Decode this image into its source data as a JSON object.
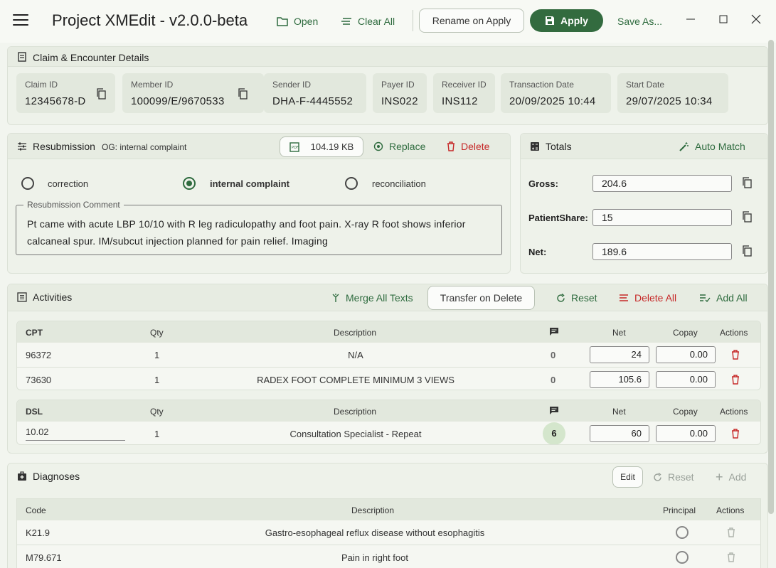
{
  "window": {
    "title": "Project XMEdit - v2.0.0-beta"
  },
  "toolbar": {
    "open_label": "Open",
    "clear_all_label": "Clear All",
    "rename_label": "Rename on Apply",
    "apply_label": "Apply",
    "save_as_label": "Save As..."
  },
  "claim": {
    "section_title": "Claim & Encounter Details",
    "fields": [
      {
        "label": "Claim ID",
        "value": "12345678-D"
      },
      {
        "label": "Member ID",
        "value": "100099/E/9670533"
      },
      {
        "label": "Sender ID",
        "value": "DHA-F-4445552"
      },
      {
        "label": "Payer ID",
        "value": "INS022"
      },
      {
        "label": "Receiver ID",
        "value": "INS112"
      },
      {
        "label": "Transaction Date",
        "value": "20/09/2025 10:44"
      },
      {
        "label": "Start Date",
        "value": "29/07/2025 10:34"
      }
    ]
  },
  "resubmission": {
    "section_title": "Resubmission",
    "og_label": "OG: internal complaint",
    "file_size": "104.19 KB",
    "replace_label": "Replace",
    "delete_label": "Delete",
    "options": [
      "correction",
      "internal complaint",
      "reconciliation"
    ],
    "selected": "internal complaint",
    "comment_label": "Resubmission Comment",
    "comment_text": "Pt came with acute LBP 10/10 with R leg radiculopathy and foot pain. X-ray R foot shows inferior calcaneal spur. IM/subcut injection planned for pain relief. Imaging"
  },
  "totals": {
    "section_title": "Totals",
    "auto_match_label": "Auto Match",
    "items": [
      {
        "label": "Gross:",
        "value": "204.6"
      },
      {
        "label": "PatientShare:",
        "value": "15"
      },
      {
        "label": "Net:",
        "value": "189.6"
      }
    ]
  },
  "activities": {
    "section_title": "Activities",
    "merge_label": "Merge All Texts",
    "transfer_label": "Transfer on Delete",
    "reset_label": "Reset",
    "delete_all_label": "Delete All",
    "add_all_label": "Add All",
    "groups": [
      {
        "code_header": "CPT",
        "qty_header": "Qty",
        "desc_header": "Description",
        "net_header": "Net",
        "copay_header": "Copay",
        "actions_header": "Actions",
        "rows": [
          {
            "code": "96372",
            "qty": "1",
            "desc": "N/A",
            "comments": "0",
            "net": "24",
            "copay": "0.00"
          },
          {
            "code": "73630",
            "qty": "1",
            "desc": "RADEX FOOT COMPLETE MINIMUM 3 VIEWS",
            "comments": "0",
            "net": "105.6",
            "copay": "0.00"
          }
        ]
      },
      {
        "code_header": "DSL",
        "qty_header": "Qty",
        "desc_header": "Description",
        "net_header": "Net",
        "copay_header": "Copay",
        "actions_header": "Actions",
        "rows": [
          {
            "code": "10.02",
            "qty": "1",
            "desc": "Consultation Specialist - Repeat",
            "comments": "6",
            "net": "60",
            "copay": "0.00"
          }
        ]
      }
    ]
  },
  "diagnoses": {
    "section_title": "Diagnoses",
    "edit_label": "Edit",
    "reset_label": "Reset",
    "add_label": "Add",
    "headers": {
      "code": "Code",
      "desc": "Description",
      "principal": "Principal",
      "actions": "Actions"
    },
    "rows": [
      {
        "code": "K21.9",
        "desc": "Gastro-esophageal reflux disease without esophagitis"
      },
      {
        "code": "M79.671",
        "desc": "Pain in right foot"
      }
    ]
  },
  "colors": {
    "accent": "#2e6b3e",
    "danger": "#c62828",
    "background": "#f2f5ef"
  }
}
